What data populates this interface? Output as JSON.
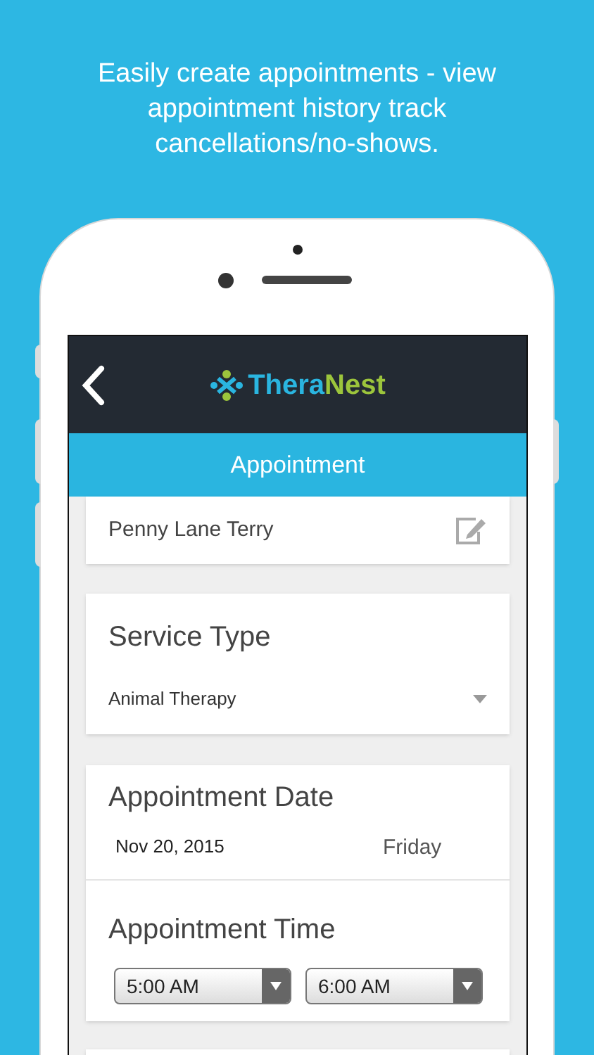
{
  "caption": "Easily create appointments - view appointment history track cancellations/no-shows.",
  "header": {
    "logo_first": "Thera",
    "logo_second": "Nest"
  },
  "title": "Appointment",
  "client": {
    "name": "Penny Lane Terry"
  },
  "service_type": {
    "label": "Service Type",
    "value": "Animal Therapy"
  },
  "appointment_date": {
    "label": "Appointment Date",
    "date": "Nov 20, 2015",
    "weekday": "Friday"
  },
  "appointment_time": {
    "label": "Appointment Time",
    "start": "5:00 AM",
    "end": "6:00 AM"
  }
}
